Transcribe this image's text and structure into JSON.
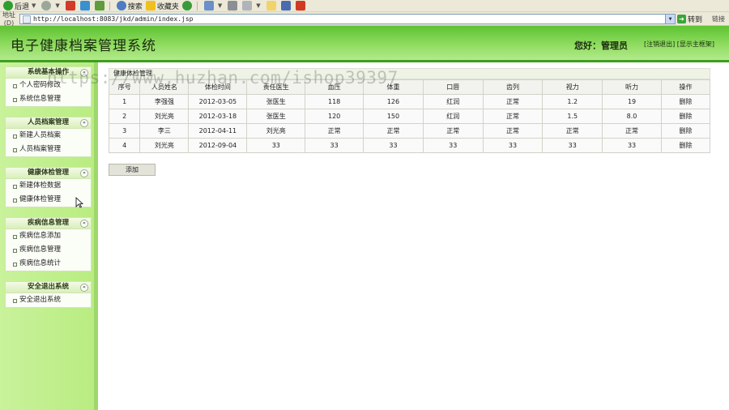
{
  "browser": {
    "toolbar": {
      "back": "后退",
      "search": "搜索",
      "favorites": "收藏夹"
    },
    "address_label": "地址(D)",
    "url": "http://localhost:8083/jkd/admin/index.jsp",
    "go": "转到",
    "links": "链接"
  },
  "header": {
    "title": "电子健康档案管理系统",
    "greeting": "您好：管理员",
    "links": "[注销退出] [显示主框架]"
  },
  "sidebar": {
    "sections": [
      {
        "title": "系统基本操作",
        "items": [
          "个人密码修改",
          "系统信息管理"
        ]
      },
      {
        "title": "人员档案管理",
        "items": [
          "新建人员档案",
          "人员档案管理"
        ]
      },
      {
        "title": "健康体检管理",
        "items": [
          "新建体检数据",
          "健康体检管理"
        ]
      },
      {
        "title": "疾病信息管理",
        "items": [
          "疾病信息添加",
          "疾病信息管理",
          "疾病信息统计"
        ]
      },
      {
        "title": "安全退出系统",
        "items": [
          "安全退出系统"
        ]
      }
    ]
  },
  "main": {
    "header": "健康体检管理",
    "columns": [
      "序号",
      "人员姓名",
      "体检时间",
      "责任医生",
      "血压",
      "体重",
      "口唇",
      "齿列",
      "视力",
      "听力",
      "操作"
    ],
    "rows": [
      [
        "1",
        "李强强",
        "2012-03-05",
        "张医生",
        "118",
        "126",
        "红润",
        "正常",
        "1.2",
        "19",
        "删除"
      ],
      [
        "2",
        "刘光亮",
        "2012-03-18",
        "张医生",
        "120",
        "150",
        "红润",
        "正常",
        "1.5",
        "8.0",
        "删除"
      ],
      [
        "3",
        "李三",
        "2012-04-11",
        "刘光亮",
        "正常",
        "正常",
        "正常",
        "正常",
        "正常",
        "正常",
        "删除"
      ],
      [
        "4",
        "刘光亮",
        "2012-09-04",
        "33",
        "33",
        "33",
        "33",
        "33",
        "33",
        "33",
        "删除"
      ]
    ],
    "add_button": "添加"
  },
  "watermark": "https://www.huzhan.com/ishop39397",
  "colors": {
    "header_green": "#6fcb3d",
    "sidebar_green": "#c0ef8a",
    "accent_dark": "#3f9e1f"
  }
}
